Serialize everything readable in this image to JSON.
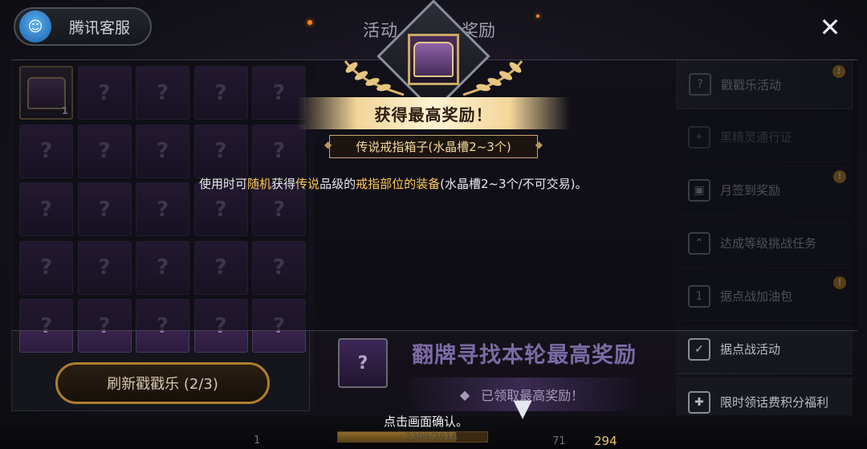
{
  "header": {
    "customer_service_label": "腾讯客服",
    "title_left": "活动",
    "title_right": "奖励",
    "close_glyph": "✕"
  },
  "grid": {
    "first_item_count": "1",
    "placeholder_glyph": "?",
    "refresh_label": "刷新戳戳乐 (2/3)"
  },
  "center": {
    "flip_text": "翻牌寻找本轮最高奖励",
    "claimed_text": "已领取最高奖励！",
    "question_glyph": "?"
  },
  "menu": {
    "items": [
      {
        "label": "戳戳乐活动",
        "icon": "question-diamond-icon",
        "badge": "!"
      },
      {
        "label": "黑精灵通行证",
        "icon": "elf-emblem-icon",
        "badge": ""
      },
      {
        "label": "月签到奖励",
        "icon": "calendar-check-icon",
        "badge": "!"
      },
      {
        "label": "达成等级挑战任务",
        "icon": "double-chevron-up-icon",
        "badge": ""
      },
      {
        "label": "据点战加油包",
        "icon": "calendar-one-icon",
        "badge": "!"
      },
      {
        "label": "据点战活动",
        "icon": "clipboard-check-icon",
        "badge": ""
      },
      {
        "label": "限时领话费积分福利",
        "icon": "gift-icon",
        "badge": ""
      }
    ]
  },
  "popup": {
    "title": "获得最高奖励！",
    "item_name": "传说戒指箱子(水晶槽2~3个)",
    "desc_1": "使用时可",
    "desc_hl_1": "随机",
    "desc_2": "获得",
    "desc_hl_2": "传说",
    "desc_3": "品级的",
    "desc_hl_3": "戒指部位的装备",
    "desc_4": "(水晶槽2~3个/不可交易)。"
  },
  "bottom": {
    "confirm_text": "点击画面确认。",
    "xp_text": "2309/2916",
    "xp_progress": 0.79,
    "slot_count_left": "1",
    "num_71": "71",
    "num_294": "294"
  },
  "colors": {
    "accent_gold": "#ffc85a",
    "badge_orange": "#d89420",
    "cell_purple": "#4a2f63"
  }
}
